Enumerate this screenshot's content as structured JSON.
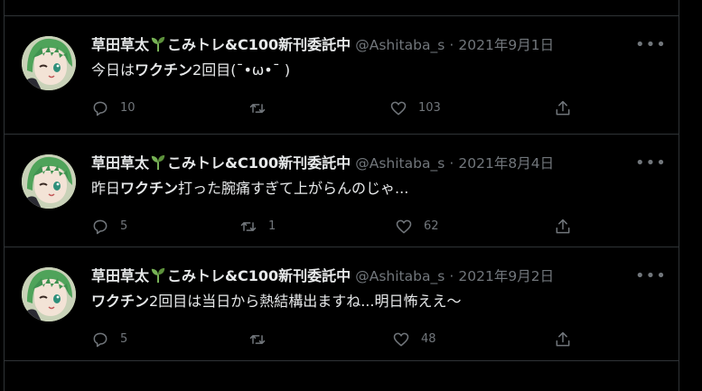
{
  "tweets": [
    {
      "display_name": "草田草太",
      "display_name_suffix": "こみトレ&C100新刊委託中",
      "handle": "@Ashitaba_s",
      "separator": "·",
      "date": "2021年9月1日",
      "text_parts": [
        "今日は",
        "ワクチン",
        "2回目(¯•ω•¯ )"
      ],
      "replies": "10",
      "retweets": "",
      "likes": "103"
    },
    {
      "display_name": "草田草太",
      "display_name_suffix": "こみトレ&C100新刊委託中",
      "handle": "@Ashitaba_s",
      "separator": "·",
      "date": "2021年8月4日",
      "text_parts": [
        "昨日",
        "ワクチン",
        "打った腕痛すぎて上がらんのじゃ..."
      ],
      "replies": "5",
      "retweets": "1",
      "likes": "62"
    },
    {
      "display_name": "草田草太",
      "display_name_suffix": "こみトレ&C100新刊委託中",
      "handle": "@Ashitaba_s",
      "separator": "·",
      "date": "2021年9月2日",
      "text_parts": [
        "",
        "ワクチン",
        "2回目は当日から熱結構出ますね...明日怖ええ～"
      ],
      "replies": "5",
      "retweets": "",
      "likes": "48"
    }
  ],
  "icons": {
    "more": "more-icon",
    "reply": "reply-icon",
    "retweet": "retweet-icon",
    "like": "like-icon",
    "share": "share-icon",
    "sprout": "sprout-emoji-icon"
  },
  "colors": {
    "background": "#000000",
    "text": "#e7e9ea",
    "secondary": "#71767b",
    "border": "#2f3336"
  }
}
